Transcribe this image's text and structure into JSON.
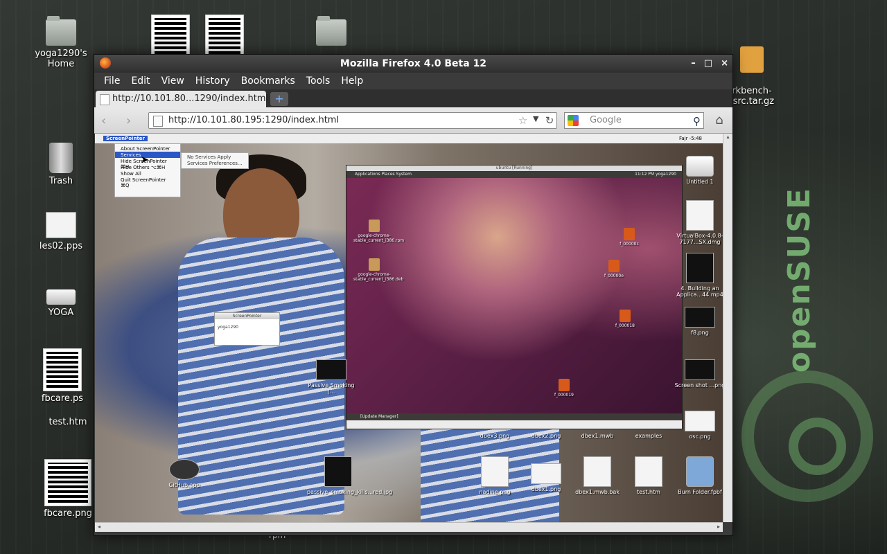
{
  "desktop": {
    "icons": [
      {
        "label": "yoga1290's Home"
      },
      {
        "label": "Trash"
      },
      {
        "label": "les02.pps"
      },
      {
        "label": "YOGA"
      },
      {
        "label": "fbcare.ps"
      },
      {
        "label": "test.htm"
      },
      {
        "label": "fbcare.png"
      },
      {
        "label": "rkbench-\n-src.tar.gz"
      }
    ],
    "brand": "openSUSE",
    "bottom_label": "rpm"
  },
  "window": {
    "title": "Mozilla Firefox 4.0 Beta 12",
    "controls": {
      "minimize": "–",
      "maximize": "□",
      "close": "×"
    }
  },
  "menubar": [
    "File",
    "Edit",
    "View",
    "History",
    "Bookmarks",
    "Tools",
    "Help"
  ],
  "tab": {
    "label": "http://10.101.80...1290/index.html",
    "new_tab": "+"
  },
  "navbar": {
    "back": "‹",
    "forward": "›",
    "url": "http://10.101.80.195:1290/index.html",
    "star": "☆",
    "dropdown": "▼",
    "reload": "↻",
    "search_placeholder": "Google",
    "search_icon": "⚲",
    "home": "⌂"
  },
  "content": {
    "mac_menubar": {
      "app": "ScreenPointer",
      "right": "Fajr -5:48"
    },
    "mac_menu": [
      "About ScreenPointer",
      "Services",
      "Hide ScreenPointer   ⌘H",
      "Hide Others   ⌥⌘H",
      "Show All",
      "Quit ScreenPointer   ⌘Q"
    ],
    "mac_submenu": [
      "No Services Apply",
      "Services Preferences..."
    ],
    "sp_window": {
      "title": "ScreenPointer",
      "body": "yoga1290"
    },
    "vm": {
      "title": "ubuntu [Running]",
      "panel_menu": "Applications  Places  System",
      "panel_right": "11:12 PM   yoga1290",
      "taskbar": "[Update Manager]",
      "icons": [
        {
          "label": "google-chrome-stable_current_i386.rpm"
        },
        {
          "label": "google-chrome-stable_current_i386.deb"
        },
        {
          "label": "f_00000c"
        },
        {
          "label": "f_00000e"
        },
        {
          "label": "f_000018"
        },
        {
          "label": "f_000019"
        }
      ]
    },
    "mac_icons": [
      {
        "label": "Untitled 1"
      },
      {
        "label": "VirtualBox-4.0.8-7177...SX.dmg"
      },
      {
        "label": "4. Building an Applica...44.mp4"
      },
      {
        "label": "f8.png"
      },
      {
        "label": "Screen shot ...png"
      },
      {
        "label": "osc.png"
      },
      {
        "label": "Passive Smoking (..."
      },
      {
        "label": "dbex3.png"
      },
      {
        "label": "dbex2.png"
      },
      {
        "label": "dbex1.mwb"
      },
      {
        "label": "examples"
      },
      {
        "label": "passive_smoking_kills...red.jpg"
      },
      {
        "label": "nadine.png"
      },
      {
        "label": "dbex1.png"
      },
      {
        "label": "dbex1.mwb.bak"
      },
      {
        "label": "test.htm"
      },
      {
        "label": "Burn Folder.fpbf"
      },
      {
        "label": "GitHub.app"
      }
    ]
  },
  "colors": {
    "accent": "#2a56c6",
    "suse_green": "#7fbf7a"
  }
}
